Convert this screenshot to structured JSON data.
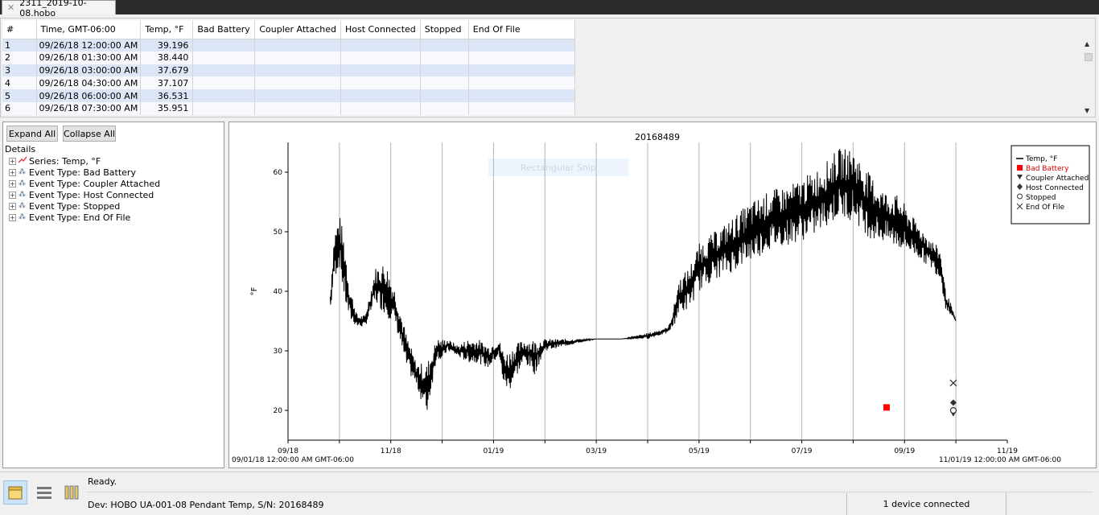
{
  "tab": {
    "filename": "2311_2019-10-08.hobo",
    "close_glyph": "✕"
  },
  "table": {
    "columns": [
      "#",
      "Time, GMT-06:00",
      "Temp, °F",
      "Bad Battery",
      "Coupler Attached",
      "Host Connected",
      "Stopped",
      "End Of File"
    ],
    "rows": [
      [
        "1",
        "09/26/18 12:00:00 AM",
        "39.196"
      ],
      [
        "2",
        "09/26/18 01:30:00 AM",
        "38.440"
      ],
      [
        "3",
        "09/26/18 03:00:00 AM",
        "37.679"
      ],
      [
        "4",
        "09/26/18 04:30:00 AM",
        "37.107"
      ],
      [
        "5",
        "09/26/18 06:00:00 AM",
        "36.531"
      ],
      [
        "6",
        "09/26/18 07:30:00 AM",
        "35.951"
      ]
    ]
  },
  "left_panel": {
    "expand_label": "Expand All",
    "collapse_label": "Collapse All",
    "details_label": "Details",
    "tree": [
      {
        "label": "Series: Temp, °F",
        "icon": "series-line-icon"
      },
      {
        "label": "Event Type: Bad Battery",
        "icon": "event-dots-icon"
      },
      {
        "label": "Event Type: Coupler Attached",
        "icon": "event-dots-icon"
      },
      {
        "label": "Event Type: Host Connected",
        "icon": "event-dots-icon"
      },
      {
        "label": "Event Type: Stopped",
        "icon": "event-dots-icon"
      },
      {
        "label": "Event Type: End Of File",
        "icon": "event-dots-icon"
      }
    ]
  },
  "chart_data": {
    "type": "line",
    "title": "20168489",
    "ylabel": "°F",
    "ylim": [
      15,
      65
    ],
    "yticks": [
      20,
      30,
      40,
      50,
      60
    ],
    "xlim_months": [
      0,
      14
    ],
    "xtick_labels": [
      "09/18",
      "11/18",
      "01/19",
      "03/19",
      "05/19",
      "07/19",
      "09/19",
      "11/19"
    ],
    "x_start_label": "09/01/18 12:00:00 AM GMT-06:00",
    "x_end_label": "11/01/19 12:00:00 AM GMT-06:00",
    "watermark": "Rectangular Snip",
    "series": [
      {
        "name": "Temp, °F",
        "color": "#000000",
        "envelope_months": [
          0.82,
          0.9,
          1.0,
          1.1,
          1.2,
          1.35,
          1.5,
          1.7,
          1.9,
          2.1,
          2.3,
          2.5,
          2.7,
          2.8,
          2.9,
          3.0,
          3.1,
          3.3,
          3.5,
          3.7,
          3.9,
          4.1,
          4.2,
          4.3,
          4.4,
          4.6,
          4.8,
          5.0,
          5.5,
          6.0,
          6.5,
          7.0,
          7.4,
          7.5,
          7.6,
          7.8,
          8.0,
          8.3,
          8.6,
          9.0,
          9.4,
          9.8,
          10.2,
          10.5,
          10.7,
          11.0,
          11.3,
          11.6,
          11.9,
          12.2,
          12.5,
          12.7,
          12.8,
          12.9,
          13.0
        ],
        "low": [
          36,
          42,
          44,
          38,
          35,
          34,
          34,
          38,
          36,
          34,
          27,
          24,
          19,
          24,
          29,
          28,
          30,
          29,
          28,
          28,
          27,
          29,
          24,
          23,
          25,
          28,
          26,
          30,
          31,
          32,
          32,
          32,
          33,
          34,
          36,
          37,
          40,
          42,
          43,
          45,
          47,
          48,
          49,
          51,
          52,
          52,
          49,
          48,
          47,
          46,
          44,
          42,
          37,
          36,
          35
        ],
        "high": [
          40,
          50,
          53,
          49,
          41,
          36,
          36,
          44,
          45,
          40,
          33,
          28,
          28,
          30,
          32,
          32,
          32,
          31,
          32,
          32,
          31,
          32,
          30,
          30,
          31,
          32,
          32,
          32,
          32,
          32,
          32,
          33,
          34,
          37,
          42,
          44,
          48,
          50,
          52,
          55,
          57,
          58,
          60,
          62,
          64,
          64,
          60,
          57,
          56,
          52,
          49,
          47,
          40,
          38,
          35
        ]
      }
    ],
    "events": [
      {
        "name": "Bad Battery",
        "x": 11.65,
        "y": 20.5,
        "color": "#ff0000",
        "marker": "filled-square"
      },
      {
        "name": "Coupler Attached",
        "x": 12.95,
        "y": 19.5,
        "color": "#333333",
        "marker": "filled-triangle-down"
      },
      {
        "name": "Host Connected",
        "x": 12.95,
        "y": 21.3,
        "color": "#333333",
        "marker": "filled-diamond"
      },
      {
        "name": "Stopped",
        "x": 12.95,
        "y": 20.0,
        "color": "#333333",
        "marker": "hollow-circle"
      },
      {
        "name": "End Of File",
        "x": 12.95,
        "y": 24.6,
        "color": "#333333",
        "marker": "x-cross"
      }
    ],
    "legend_placement": "top-right",
    "grid_x": true
  },
  "status": {
    "ready": "Ready.",
    "device": "Dev: HOBO UA-001-08 Pendant Temp, S/N: 20168489",
    "devices_connected": "1 device connected"
  }
}
